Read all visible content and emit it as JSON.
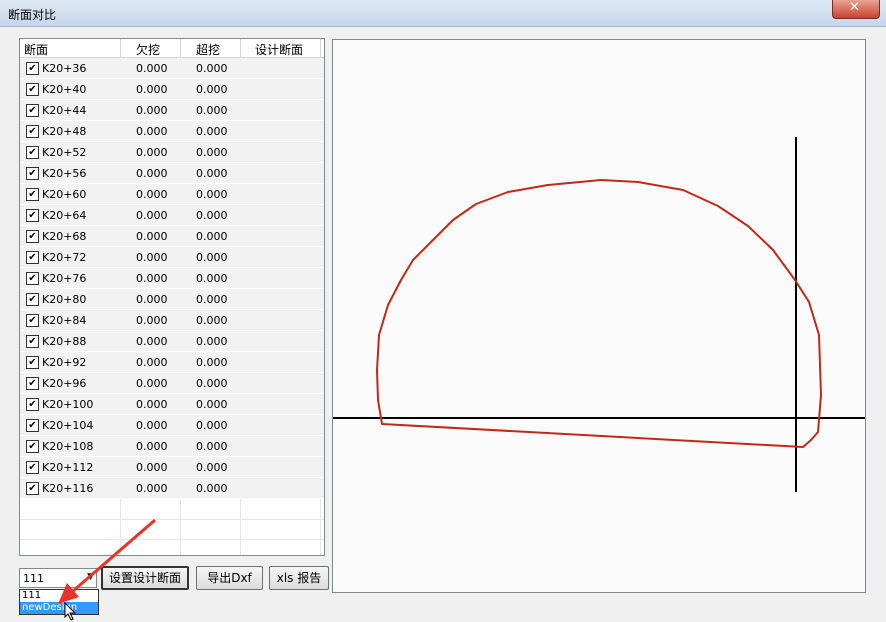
{
  "window": {
    "title": "断面对比",
    "close_glyph": "✕"
  },
  "table": {
    "headers": {
      "name": "断面",
      "under": "欠挖",
      "over": "超挖",
      "design": "设计断面"
    },
    "rows": [
      {
        "name": "K20+36",
        "under": "0.000",
        "over": "0.000",
        "checked": true
      },
      {
        "name": "K20+40",
        "under": "0.000",
        "over": "0.000",
        "checked": true
      },
      {
        "name": "K20+44",
        "under": "0.000",
        "over": "0.000",
        "checked": true
      },
      {
        "name": "K20+48",
        "under": "0.000",
        "over": "0.000",
        "checked": true
      },
      {
        "name": "K20+52",
        "under": "0.000",
        "over": "0.000",
        "checked": true
      },
      {
        "name": "K20+56",
        "under": "0.000",
        "over": "0.000",
        "checked": true
      },
      {
        "name": "K20+60",
        "under": "0.000",
        "over": "0.000",
        "checked": true
      },
      {
        "name": "K20+64",
        "under": "0.000",
        "over": "0.000",
        "checked": true
      },
      {
        "name": "K20+68",
        "under": "0.000",
        "over": "0.000",
        "checked": true
      },
      {
        "name": "K20+72",
        "under": "0.000",
        "over": "0.000",
        "checked": true
      },
      {
        "name": "K20+76",
        "under": "0.000",
        "over": "0.000",
        "checked": true
      },
      {
        "name": "K20+80",
        "under": "0.000",
        "over": "0.000",
        "checked": true
      },
      {
        "name": "K20+84",
        "under": "0.000",
        "over": "0.000",
        "checked": true
      },
      {
        "name": "K20+88",
        "under": "0.000",
        "over": "0.000",
        "checked": true
      },
      {
        "name": "K20+92",
        "under": "0.000",
        "over": "0.000",
        "checked": true
      },
      {
        "name": "K20+96",
        "under": "0.000",
        "over": "0.000",
        "checked": true
      },
      {
        "name": "K20+100",
        "under": "0.000",
        "over": "0.000",
        "checked": true
      },
      {
        "name": "K20+104",
        "under": "0.000",
        "over": "0.000",
        "checked": true
      },
      {
        "name": "K20+108",
        "under": "0.000",
        "over": "0.000",
        "checked": true
      },
      {
        "name": "K20+112",
        "under": "0.000",
        "over": "0.000",
        "checked": true
      },
      {
        "name": "K20+116",
        "under": "0.000",
        "over": "0.000",
        "checked": true
      }
    ],
    "check_glyph": "✔"
  },
  "combo": {
    "value": "111",
    "arrow_glyph": "▼",
    "options": [
      "111",
      "newDesign"
    ],
    "selected_index": 1
  },
  "buttons": {
    "set_design": "设置设计断面",
    "export_dxf": "导出Dxf",
    "xls_report": "xls 报告"
  },
  "plot": {
    "profile_color": "#c0291a",
    "axis_color": "#000000"
  },
  "annotation": {
    "arrow_color": "#e8322a"
  }
}
